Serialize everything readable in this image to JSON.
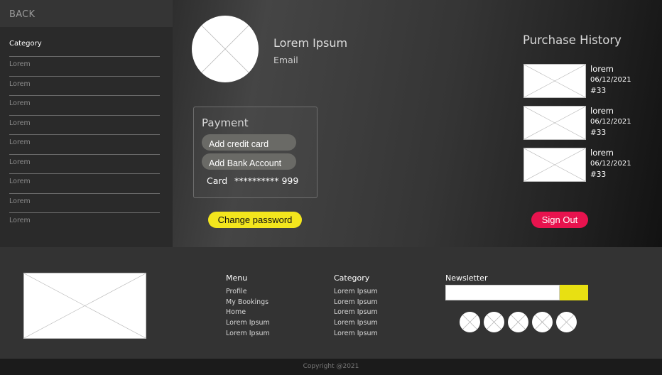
{
  "sidebar": {
    "back_label": "BACK",
    "category_title": "Category",
    "items": [
      "Lorem",
      "Lorem",
      "Lorem",
      "Lorem",
      "Lorem",
      "Lorem",
      "Lorem",
      "Lorem",
      "Lorem"
    ]
  },
  "profile": {
    "name": "Lorem Ipsum",
    "email": "Email"
  },
  "payment": {
    "title": "Payment",
    "add_card_label": "Add credit card",
    "add_bank_label": "Add Bank Account",
    "card_label": "Card",
    "card_number": "********** 999"
  },
  "actions": {
    "change_password_label": "Change password",
    "sign_out_label": "Sign Out"
  },
  "purchase_history": {
    "title": "Purchase History",
    "items": [
      {
        "name": "lorem",
        "date": "06/12/2021",
        "number": "#33"
      },
      {
        "name": "lorem",
        "date": "06/12/2021",
        "number": "#33"
      },
      {
        "name": "lorem",
        "date": "06/12/2021",
        "number": "#33"
      }
    ]
  },
  "footer": {
    "menu": {
      "title": "Menu",
      "links": [
        "Profile",
        "My Bookings",
        "Home",
        "Lorem Ipsum",
        "Lorem Ipsum"
      ]
    },
    "category": {
      "title": "Category",
      "links": [
        "Lorem Ipsum",
        "Lorem Ipsum",
        "Lorem Ipsum",
        "Lorem Ipsum",
        "Lorem Ipsum"
      ]
    },
    "newsletter": {
      "title": "Newsletter",
      "input_value": "",
      "input_placeholder": ""
    },
    "social_icons": [
      "social-icon-1",
      "social-icon-2",
      "social-icon-3",
      "social-icon-4",
      "social-icon-5"
    ],
    "copyright": "Copyright @2021"
  },
  "colors": {
    "accent_yellow": "#f3e61d",
    "accent_red": "#e8134e",
    "sidebar_bg": "#2a2a2a",
    "footer_bg": "#333333"
  }
}
